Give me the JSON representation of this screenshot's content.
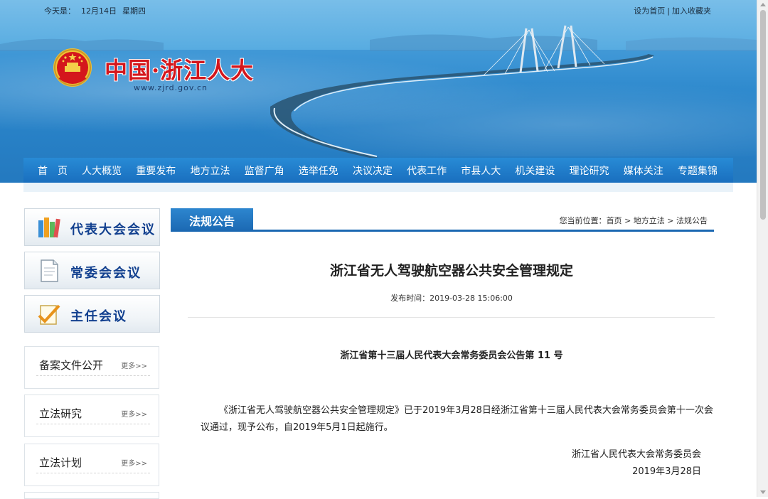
{
  "header": {
    "date_label": "今天是：",
    "date": "12月14日",
    "weekday": "星期四",
    "set_home": "设为首页",
    "separator": "|",
    "add_favorite": "加入收藏夹",
    "site_title": "中国·浙江人大",
    "site_url": "www.zjrd.gov.cn"
  },
  "nav": {
    "items": [
      "首　页",
      "人大概览",
      "重要发布",
      "地方立法",
      "监督广角",
      "选举任免",
      "决议决定",
      "代表工作",
      "市县人大",
      "机关建设",
      "理论研究",
      "媒体关注",
      "专题集锦"
    ]
  },
  "sidebar": {
    "buttons": [
      {
        "label": "代表大会会议",
        "icon": "books-icon"
      },
      {
        "label": "常委会会议",
        "icon": "document-icon"
      },
      {
        "label": "主任会议",
        "icon": "pen-check-icon"
      }
    ],
    "boxes": [
      {
        "title": "备案文件公开",
        "more": "更多>>"
      },
      {
        "title": "立法研究",
        "more": "更多>>"
      },
      {
        "title": "立法计划",
        "more": "更多>>"
      }
    ]
  },
  "section": {
    "tab": "法规公告",
    "breadcrumb_label": "您当前位置：",
    "crumbs": [
      "首页",
      "地方立法",
      "法规公告"
    ],
    "crumb_sep": ">"
  },
  "article": {
    "title": "浙江省无人驾驶航空器公共安全管理规定",
    "publish_label": "发布时间：",
    "publish_time": "2019-03-28 15:06:00",
    "announcement": "浙江省第十三届人民代表大会常务委员会公告第 11 号",
    "body": "《浙江省无人驾驶航空器公共安全管理规定》已于2019年3月28日经浙江省第十三届人民代表大会常务委员会第十一次会议通过，现予公布，自2019年5月1日起施行。",
    "signatory": "浙江省人民代表大会常务委员会",
    "sign_date": "2019年3月28日"
  },
  "colors": {
    "brand_red": "#d4161c",
    "nav_blue": "#1b68b2",
    "sidebar_text": "#12408f"
  }
}
